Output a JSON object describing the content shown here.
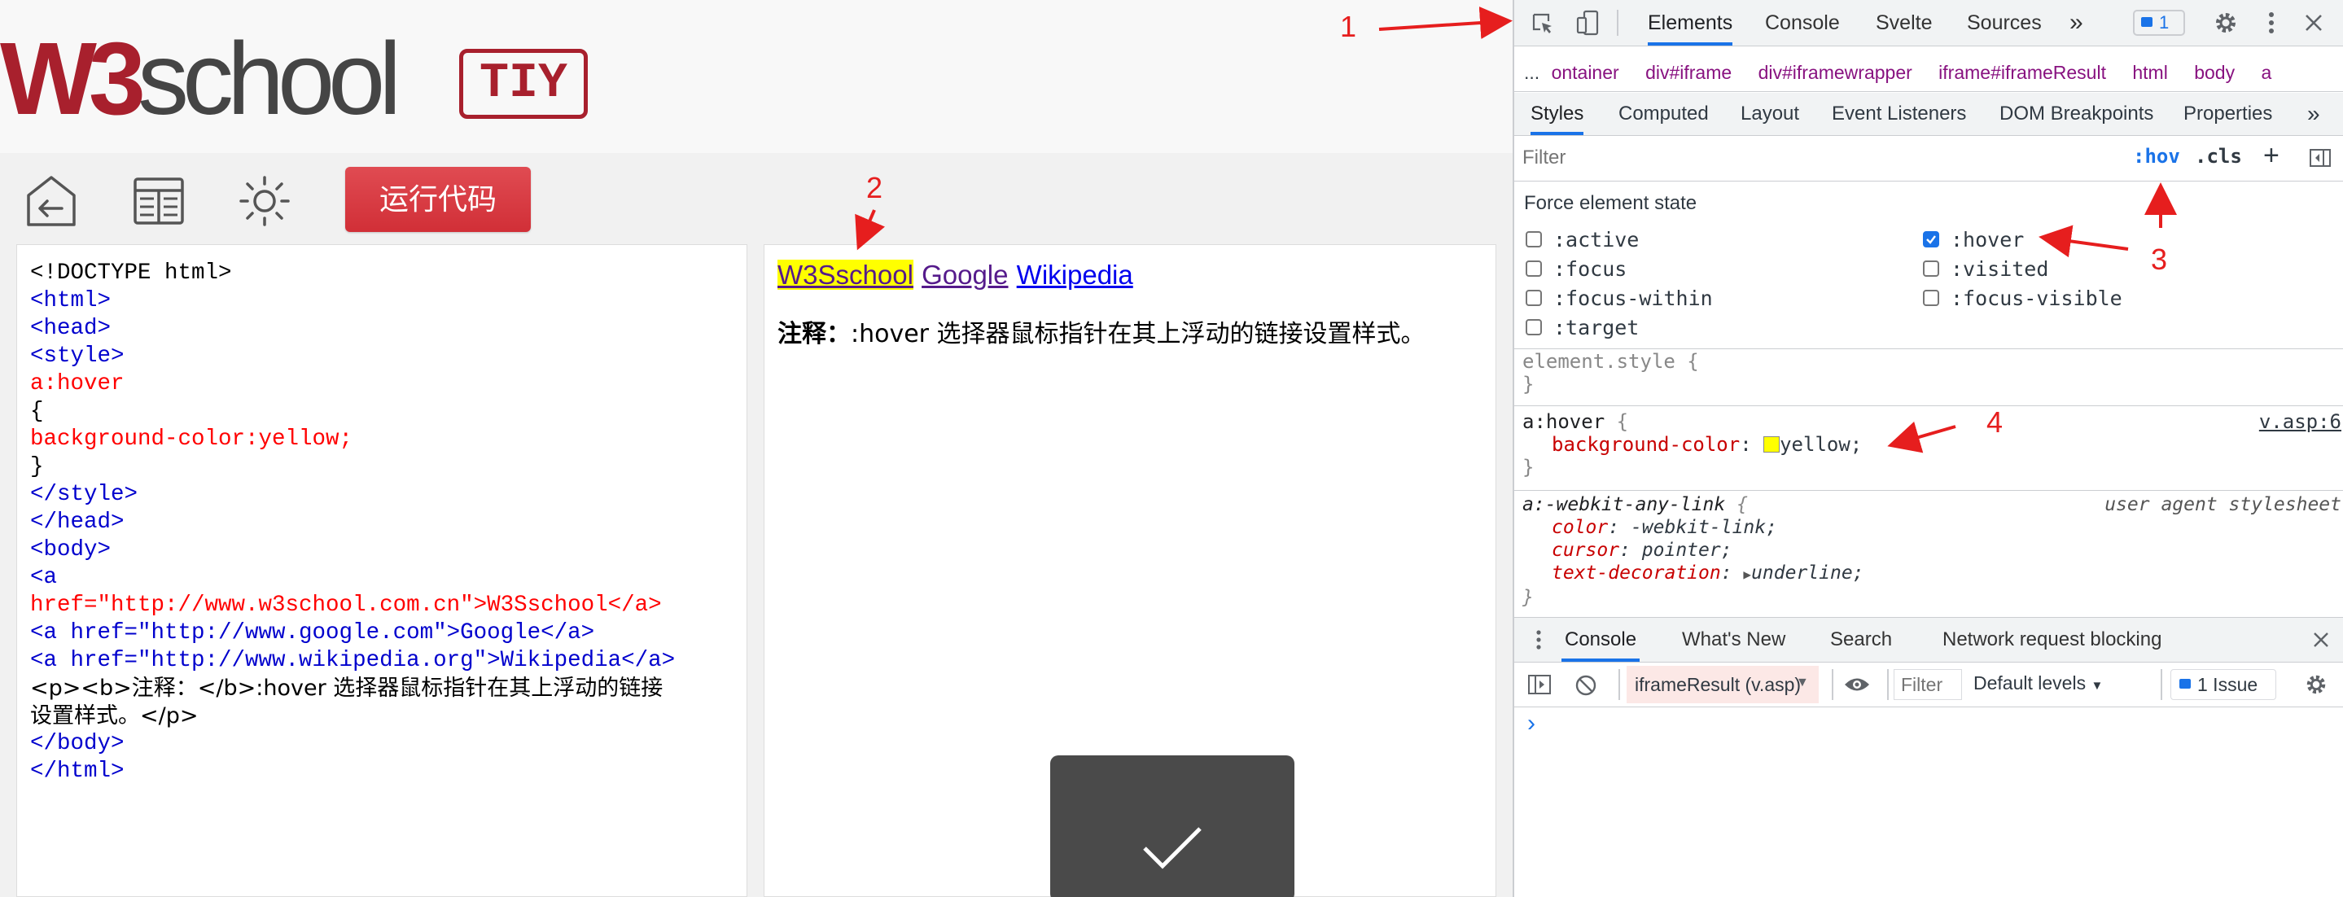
{
  "header": {
    "logo_w3": "W3",
    "logo_school": "school",
    "tiy": "TIY",
    "run_button": "运行代码"
  },
  "code_lines": [
    "<!DOCTYPE html>",
    "<html>",
    "<head>",
    "<style>",
    "a:hover",
    "{",
    "background-color:yellow;",
    "}",
    "</style>",
    "</head>",
    "<body>",
    "",
    "<a",
    "href=\"http://www.w3school.com.cn\">W3Sschool</a>",
    "<a href=\"http://www.google.com\">Google</a>",
    "<a href=\"http://www.wikipedia.org\">Wikipedia</a>",
    "",
    "<p><b>注释：</b>:hover 选择器鼠标指针在其上浮动的链接",
    "设置样式。</p>",
    "",
    "</body>",
    "</html>"
  ],
  "result": {
    "link1": "W3Sschool",
    "link2": "Google",
    "link3": "Wikipedia",
    "note_bold": "注释：",
    "note_text": ":hover 选择器鼠标指针在其上浮动的链接设置样式。"
  },
  "devtools": {
    "tabs": [
      "Elements",
      "Console",
      "Svelte",
      "Sources"
    ],
    "more_tabs": "»",
    "issues_badge": "1",
    "breadcrumb": [
      "ontainer",
      "div#iframe",
      "div#iframewrapper",
      "iframe#iframeResult",
      "html",
      "body",
      "a"
    ],
    "breadcrumb_more": "...",
    "subtabs": [
      "Styles",
      "Computed",
      "Layout",
      "Event Listeners",
      "DOM Breakpoints",
      "Properties"
    ],
    "subtabs_more": "»",
    "filter_placeholder": "Filter",
    "hov": ":hov",
    "cls": ".cls",
    "plus": "+",
    "force_state_title": "Force element state",
    "states_left": [
      ":active",
      ":focus",
      ":focus-within",
      ":target"
    ],
    "states_right": [
      ":hover",
      ":visited",
      ":focus-visible"
    ],
    "hover_checked": true,
    "element_style_open": "element.style {",
    "close_brace": "}",
    "hover_rule_selector": "a:hover",
    "hover_rule_open": " {",
    "hover_rule_source": "v.asp:6",
    "hover_prop": "background-color",
    "hover_value": "yellow;",
    "ua_selector": "a:-webkit-any-link",
    "ua_open": " {",
    "ua_source": "user agent stylesheet",
    "ua_props": [
      {
        "name": "color",
        "value": "-webkit-link;"
      },
      {
        "name": "cursor",
        "value": "pointer;"
      },
      {
        "name": "text-decoration",
        "value": "underline;"
      }
    ],
    "drawer_tabs": [
      "Console",
      "What's New",
      "Search",
      "Network request blocking"
    ],
    "context": "iframeResult (v.asp)",
    "console_filter": "Filter",
    "levels": "Default levels",
    "issues": "1 Issue",
    "prompt": "›"
  },
  "annotations": [
    "1",
    "2",
    "3",
    "4"
  ],
  "colors": {
    "accent": "#1a73e8",
    "brand": "#a8202d",
    "run": "#d9363e",
    "arrow": "#e61e1e"
  }
}
